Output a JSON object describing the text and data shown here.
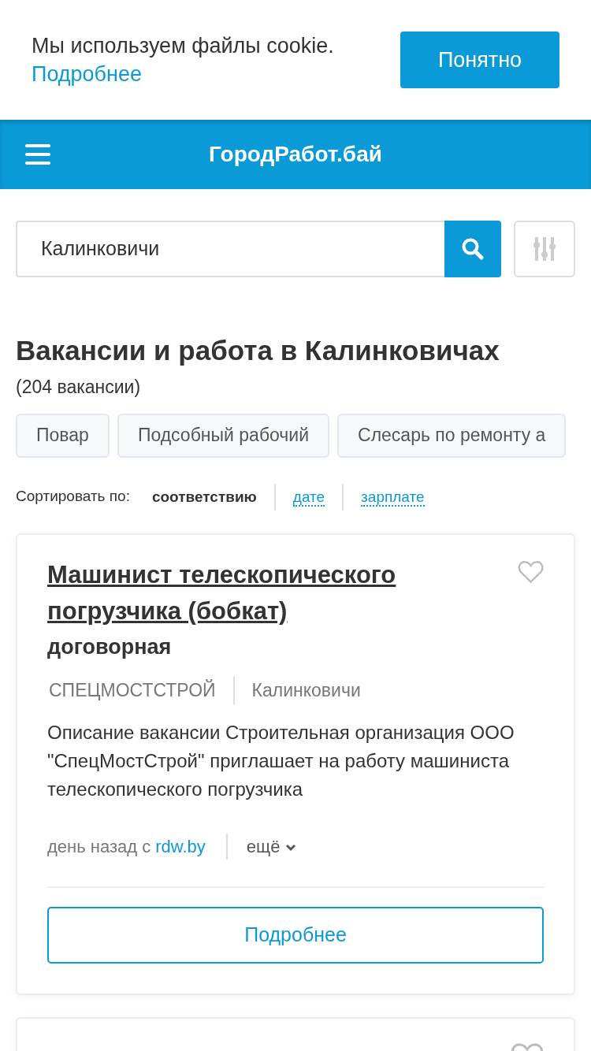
{
  "cookie_banner": {
    "text": "Мы используем файлы cookie.",
    "link": "Подробнее",
    "button": "Понятно"
  },
  "header": {
    "logo": "ГородРабот.бай"
  },
  "search": {
    "value": "Калинковичи"
  },
  "heading": "Вакансии и работа в Калинковичах",
  "count": "(204 вакансии)",
  "tags": [
    "Повар",
    "Подсобный рабочий",
    "Слесарь по ремонту а"
  ],
  "sort": {
    "label": "Сортировать по:",
    "options": [
      {
        "label": "соответствию",
        "selected": true
      },
      {
        "label": "дате",
        "selected": false
      },
      {
        "label": "зарплате",
        "selected": false
      }
    ]
  },
  "vacancies": [
    {
      "title": "Машинист телескопического погрузчика (бобкат)",
      "salary": "договорная",
      "company": "СПЕЦМОСТСТРОЙ",
      "city": "Калинковичи",
      "description": "Описание вакансии Строительная организация ООО \"СпецМостСтрой\" приглашает на работу машиниста телескопического погрузчика",
      "posted": "день назад с",
      "source": "rdw.by",
      "more": "ещё",
      "button": "Подробнее",
      "favorite": false
    },
    {
      "favorite": false
    }
  ]
}
